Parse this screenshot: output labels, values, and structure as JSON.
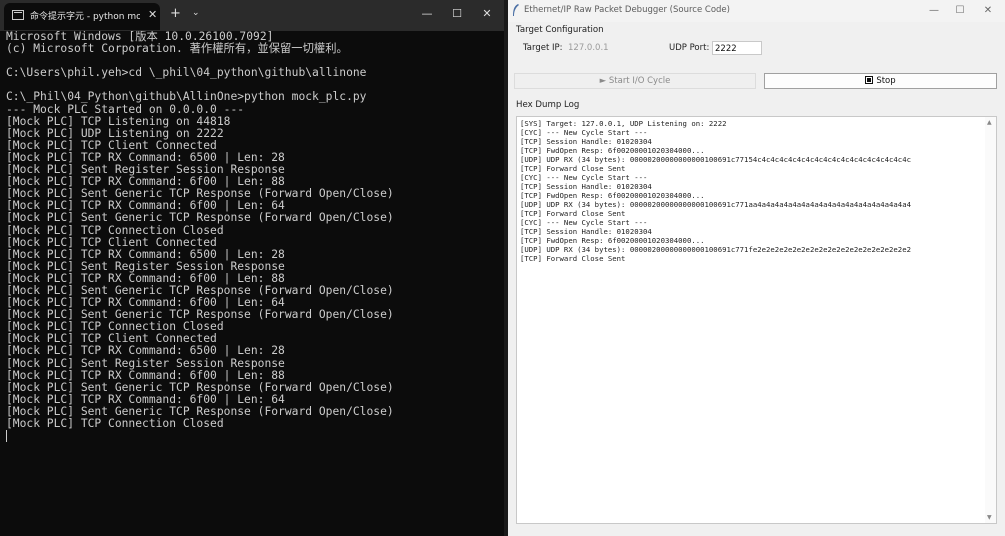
{
  "terminal": {
    "tab_title": "命令提示字元 - python  mock_",
    "tab_close": "✕",
    "new_tab": "+",
    "dropdown": "⌄",
    "window_buttons": {
      "minimize": "—",
      "maximize": "☐",
      "close": "✕"
    },
    "lines": [
      "Microsoft Windows [版本 10.0.26100.7092]",
      "(c) Microsoft Corporation. 著作權所有，並保留一切權利。",
      "",
      "C:\\Users\\phil.yeh>cd \\_phil\\04_python\\github\\allinone",
      "",
      "C:\\_Phil\\04_Python\\github\\AllinOne>python mock_plc.py",
      "--- Mock PLC Started on 0.0.0.0 ---",
      "[Mock PLC] TCP Listening on 44818",
      "[Mock PLC] UDP Listening on 2222",
      "[Mock PLC] TCP Client Connected",
      "[Mock PLC] TCP RX Command: 6500 | Len: 28",
      "[Mock PLC] Sent Register Session Response",
      "[Mock PLC] TCP RX Command: 6f00 | Len: 88",
      "[Mock PLC] Sent Generic TCP Response (Forward Open/Close)",
      "[Mock PLC] TCP RX Command: 6f00 | Len: 64",
      "[Mock PLC] Sent Generic TCP Response (Forward Open/Close)",
      "[Mock PLC] TCP Connection Closed",
      "[Mock PLC] TCP Client Connected",
      "[Mock PLC] TCP RX Command: 6500 | Len: 28",
      "[Mock PLC] Sent Register Session Response",
      "[Mock PLC] TCP RX Command: 6f00 | Len: 88",
      "[Mock PLC] Sent Generic TCP Response (Forward Open/Close)",
      "[Mock PLC] TCP RX Command: 6f00 | Len: 64",
      "[Mock PLC] Sent Generic TCP Response (Forward Open/Close)",
      "[Mock PLC] TCP Connection Closed",
      "[Mock PLC] TCP Client Connected",
      "[Mock PLC] TCP RX Command: 6500 | Len: 28",
      "[Mock PLC] Sent Register Session Response",
      "[Mock PLC] TCP RX Command: 6f00 | Len: 88",
      "[Mock PLC] Sent Generic TCP Response (Forward Open/Close)",
      "[Mock PLC] TCP RX Command: 6f00 | Len: 64",
      "[Mock PLC] Sent Generic TCP Response (Forward Open/Close)",
      "[Mock PLC] TCP Connection Closed"
    ]
  },
  "app": {
    "title": "Ethernet/IP Raw Packet Debugger (Source Code)",
    "window_buttons": {
      "minimize": "—",
      "maximize": "☐",
      "close": "✕"
    },
    "target_config": {
      "section_label": "Target Configuration",
      "ip_label": "Target IP:",
      "ip_value": "127.0.0.1",
      "udp_label": "UDP Port:",
      "udp_value": "2222"
    },
    "buttons": {
      "start_label": "► Start I/O Cycle",
      "stop_label": "Stop"
    },
    "log": {
      "section_label": "Hex Dump Log",
      "lines": [
        "[SYS] Target: 127.0.0.1, UDP Listening on: 2222",
        "[CYC] --- New Cycle Start ---",
        "[TCP] Session Handle: 01020304",
        "[TCP] FwdOpen Resp: 6f00200001020304000...",
        "[UDP] UDP RX (34 bytes): 00000200000000000100691c77154c4c4c4c4c4c4c4c4c4c4c4c4c4c4c4c4c4c",
        "[TCP] Forward Close Sent",
        "[CYC] --- New Cycle Start ---",
        "[TCP] Session Handle: 01020304",
        "[TCP] FwdOpen Resp: 6f00200001020304000...",
        "[UDP] UDP RX (34 bytes): 00000200000000000100691c771aa4a4a4a4a4a4a4a4a4a4a4a4a4a4a4a4a4a4",
        "[TCP] Forward Close Sent",
        "[CYC] --- New Cycle Start ---",
        "[TCP] Session Handle: 01020304",
        "[TCP] FwdOpen Resp: 6f00200001020304000...",
        "[UDP] UDP RX (34 bytes): 00000200000000000100691c771fe2e2e2e2e2e2e2e2e2e2e2e2e2e2e2e2e2e2",
        "[TCP] Forward Close Sent"
      ]
    },
    "scroll_up": "▲",
    "scroll_down": "▼"
  }
}
